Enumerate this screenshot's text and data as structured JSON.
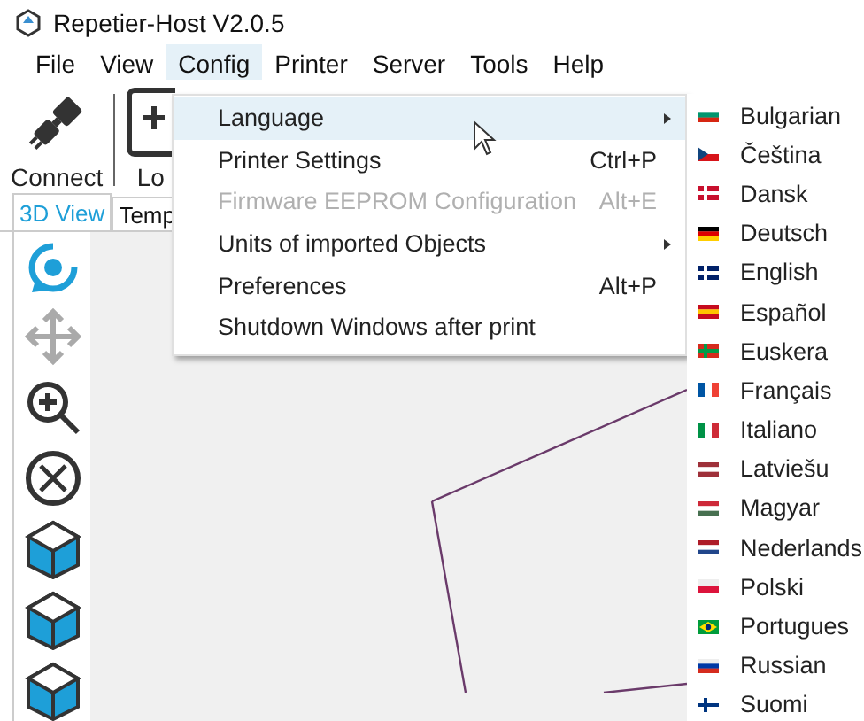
{
  "window": {
    "title": "Repetier-Host V2.0.5"
  },
  "menu_bar": [
    {
      "label": "File",
      "selected": false
    },
    {
      "label": "View",
      "selected": false
    },
    {
      "label": "Config",
      "selected": true
    },
    {
      "label": "Printer",
      "selected": false
    },
    {
      "label": "Server",
      "selected": false
    },
    {
      "label": "Tools",
      "selected": false
    },
    {
      "label": "Help",
      "selected": false
    }
  ],
  "toolbar": [
    {
      "label": "Connect",
      "kind": "connect"
    },
    {
      "label": "Lo",
      "kind": "load"
    }
  ],
  "tabs": [
    {
      "label": "3D View",
      "selected": true
    },
    {
      "label": "Temp",
      "selected": false
    }
  ],
  "config_menu": [
    {
      "label": "Language",
      "disabled": false,
      "submenu": true,
      "selected": true
    },
    {
      "label": "Printer Settings",
      "shortcut": "Ctrl+P",
      "disabled": false,
      "submenu": false,
      "selected": false
    },
    {
      "label": "Firmware EEPROM Configuration",
      "shortcut": "Alt+E",
      "disabled": true,
      "submenu": false,
      "selected": false
    },
    {
      "label": "Units of imported Objects",
      "disabled": false,
      "submenu": true,
      "selected": false
    },
    {
      "label": "Preferences",
      "shortcut": "Alt+P",
      "disabled": false,
      "submenu": false,
      "selected": false
    },
    {
      "label": "Shutdown Windows after print",
      "disabled": false,
      "submenu": false,
      "selected": false
    }
  ],
  "languages": [
    {
      "label": "Bulgarian",
      "kind": "bg"
    },
    {
      "label": "Čeština",
      "kind": "cz"
    },
    {
      "label": "Dansk",
      "kind": "dk"
    },
    {
      "label": "Deutsch",
      "kind": "de"
    },
    {
      "label": "English",
      "kind": "gb"
    },
    {
      "label": "Español",
      "kind": "es"
    },
    {
      "label": "Euskera",
      "kind": "eu"
    },
    {
      "label": "Français",
      "kind": "fr"
    },
    {
      "label": "Italiano",
      "kind": "it"
    },
    {
      "label": "Latviešu",
      "kind": "lv"
    },
    {
      "label": "Magyar",
      "kind": "hu"
    },
    {
      "label": "Nederlands",
      "kind": "nl"
    },
    {
      "label": "Polski",
      "kind": "pl"
    },
    {
      "label": "Portugues",
      "kind": "br"
    },
    {
      "label": "Russian",
      "kind": "ru"
    },
    {
      "label": "Suomi",
      "kind": "fi"
    }
  ]
}
